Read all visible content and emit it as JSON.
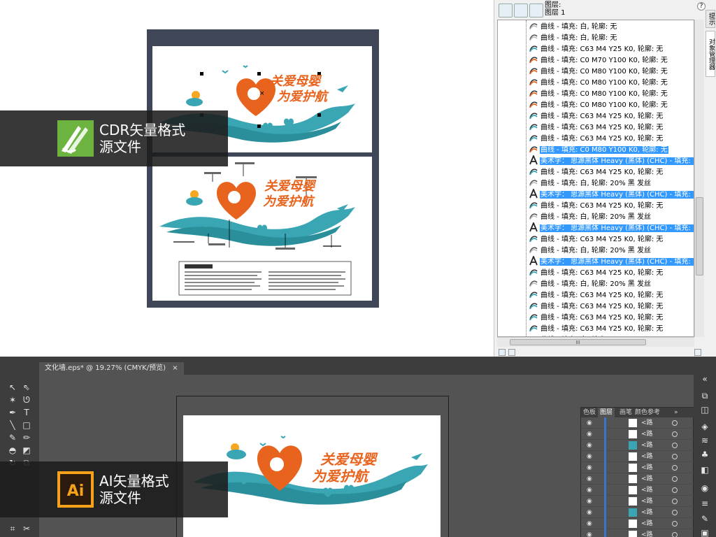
{
  "cdr": {
    "label_line1": "CDR矢量格式",
    "label_line2": "源文件",
    "artwork": {
      "title_line1": "关爱母婴",
      "title_line2": "为爱护航"
    }
  },
  "object_manager": {
    "layer_title": "图层:",
    "layer_name": "图层 1",
    "help": "?",
    "vtabs": [
      "提示",
      "对象管理器"
    ],
    "rows": [
      {
        "text": "曲线 - 填充: 白, 轮廓: 无",
        "icon": "curve",
        "sel": false
      },
      {
        "text": "曲线 - 填充: 白, 轮廓: 无",
        "icon": "curve",
        "sel": false
      },
      {
        "text": "曲线 - 填充: C63 M4 Y25 K0, 轮廓: 无",
        "icon": "curve-teal",
        "sel": false
      },
      {
        "text": "曲线 - 填充: C0 M70 Y100 K0, 轮廓: 无",
        "icon": "curve-orange",
        "sel": false
      },
      {
        "text": "曲线 - 填充: C0 M80 Y100 K0, 轮廓: 无",
        "icon": "curve-orange",
        "sel": false
      },
      {
        "text": "曲线 - 填充: C0 M80 Y100 K0, 轮廓: 无",
        "icon": "curve-orange",
        "sel": false
      },
      {
        "text": "曲线 - 填充: C0 M80 Y100 K0, 轮廓: 无",
        "icon": "curve-orange",
        "sel": false
      },
      {
        "text": "曲线 - 填充: C0 M80 Y100 K0, 轮廓: 无",
        "icon": "curve-orange",
        "sel": false
      },
      {
        "text": "曲线 - 填充: C63 M4 Y25 K0, 轮廓: 无",
        "icon": "curve-teal",
        "sel": false
      },
      {
        "text": "曲线 - 填充: C63 M4 Y25 K0, 轮廓: 无",
        "icon": "curve-teal",
        "sel": false
      },
      {
        "text": "曲线 - 填充: C63 M4 Y25 K0, 轮廓: 无",
        "icon": "curve-teal",
        "sel": false
      },
      {
        "text": "曲线 - 填充: C0 M80 Y100 K0, 轮廓: 无",
        "icon": "curve-orange",
        "sel": true
      },
      {
        "text": "美术字： 思源黑体 Heavy (黑体) (CHC) - 填充: 白",
        "icon": "text",
        "sel": true
      },
      {
        "text": "曲线 - 填充: C63 M4 Y25 K0, 轮廓: 无",
        "icon": "curve-teal",
        "sel": false
      },
      {
        "text": "曲线 - 填充: 白, 轮廓: 20% 黑 发丝",
        "icon": "curve",
        "sel": false
      },
      {
        "text": "美术字： 思源黑体 Heavy (黑体) (CHC) - 填充: 白",
        "icon": "text",
        "sel": true
      },
      {
        "text": "曲线 - 填充: C63 M4 Y25 K0, 轮廓: 无",
        "icon": "curve-teal",
        "sel": false
      },
      {
        "text": "曲线 - 填充: 白, 轮廓: 20% 黑 发丝",
        "icon": "curve",
        "sel": false
      },
      {
        "text": "美术字： 思源黑体 Heavy (黑体) (CHC) - 填充: 白",
        "icon": "text",
        "sel": true
      },
      {
        "text": "曲线 - 填充: C63 M4 Y25 K0, 轮廓: 无",
        "icon": "curve-teal",
        "sel": false
      },
      {
        "text": "曲线 - 填充: 白, 轮廓: 20% 黑 发丝",
        "icon": "curve",
        "sel": false
      },
      {
        "text": "美术字： 思源黑体 Heavy (黑体) (CHC) - 填充: 白",
        "icon": "text",
        "sel": true
      },
      {
        "text": "曲线 - 填充: C63 M4 Y25 K0, 轮廓: 无",
        "icon": "curve-teal",
        "sel": false
      },
      {
        "text": "曲线 - 填充: 白, 轮廓: 20% 黑 发丝",
        "icon": "curve",
        "sel": false
      },
      {
        "text": "曲线 - 填充: C63 M4 Y25 K0, 轮廓: 无",
        "icon": "curve-teal",
        "sel": false
      },
      {
        "text": "曲线 - 填充: C63 M4 Y25 K0, 轮廓: 无",
        "icon": "curve-teal",
        "sel": false
      },
      {
        "text": "曲线 - 填充: C63 M4 Y25 K0, 轮廓: 无",
        "icon": "curve-teal",
        "sel": false
      },
      {
        "text": "曲线 - 填充: C63 M4 Y25 K0, 轮廓: 无",
        "icon": "curve-teal",
        "sel": false
      },
      {
        "text": "曲线 - 填充: 白, 轮廓: 无",
        "icon": "curve",
        "sel": false
      }
    ],
    "hscroll_mark": "III"
  },
  "ai": {
    "doc_tab": "文化墙.eps* @ 19.27% (CMYK/预览)",
    "close_label": "×",
    "label_line1": "AI矢量格式",
    "label_line2": "源文件",
    "artwork": {
      "title_line1": "关爱母婴",
      "title_line2": "为爱护航"
    },
    "layers_panel": {
      "tabs": [
        "色板",
        "图层",
        "画笔",
        "颜色参考"
      ],
      "menu": "»",
      "row_name": "<路"
    }
  },
  "colors": {
    "orange": "#e8641e",
    "teal": "#3aa6b3",
    "selection": "#3399ff"
  }
}
